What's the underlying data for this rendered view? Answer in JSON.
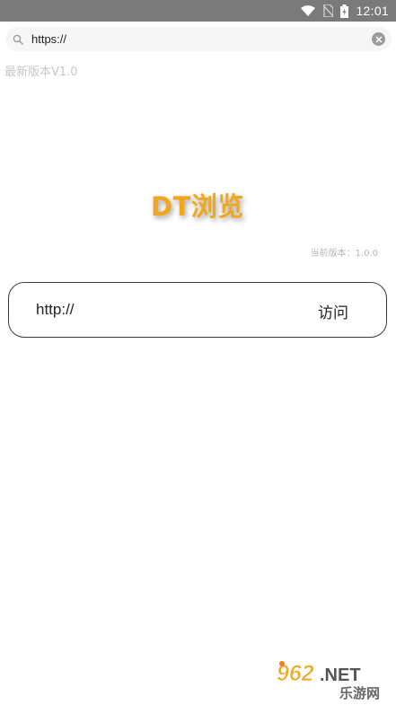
{
  "status_bar": {
    "time": "12:01"
  },
  "address_bar": {
    "url_value": "https://"
  },
  "version_label": "最新版本V1.0",
  "brand_title": "DT浏览",
  "current_version": "当前版本：1.0.0",
  "visit_box": {
    "url_value": "http://",
    "button_label": "访问"
  },
  "watermark": {
    "domain": "962.NET",
    "tagline": "乐游网"
  },
  "colors": {
    "brand": "#f0a61d",
    "status_bar": "#7a7a7a"
  }
}
